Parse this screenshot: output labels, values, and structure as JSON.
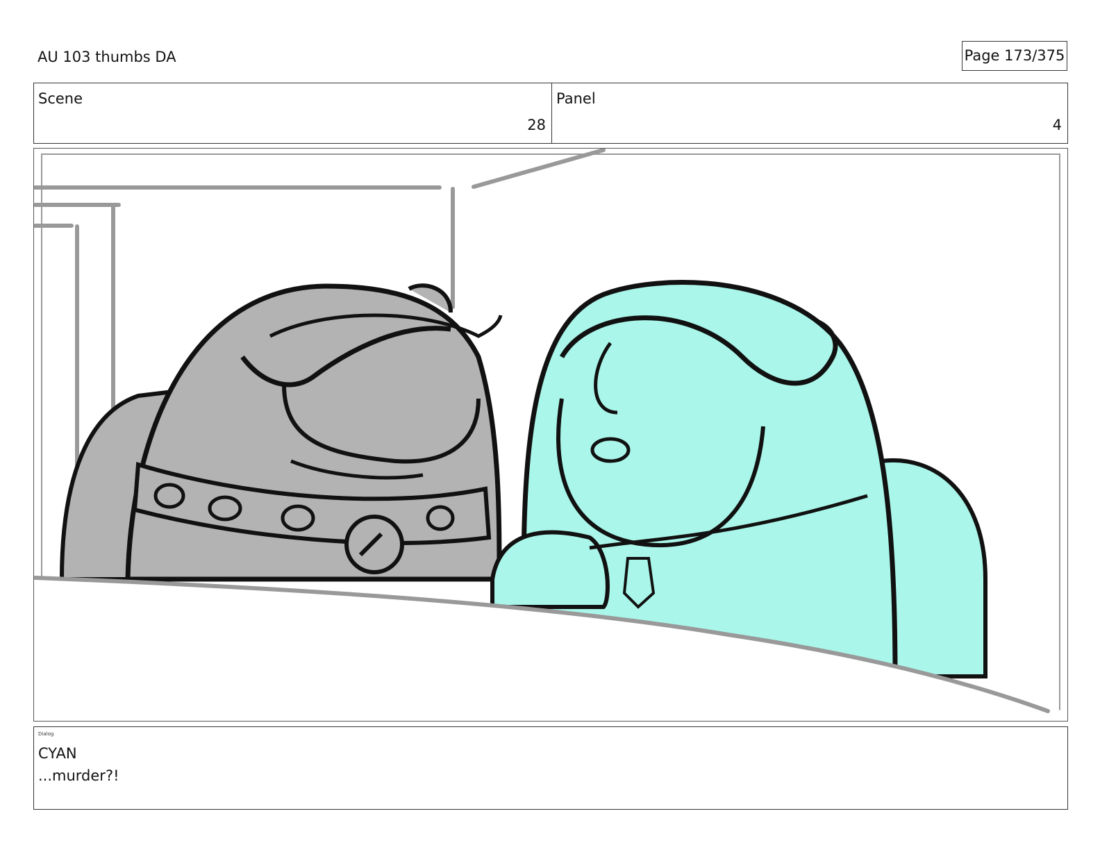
{
  "header": {
    "title": "AU 103 thumbs DA",
    "page": "Page 173/375"
  },
  "info": {
    "scene_label": "Scene",
    "scene_value": "28",
    "panel_label": "Panel",
    "panel_value": "4"
  },
  "panel_art": {
    "description_icons": [
      "grey-character",
      "cyan-character",
      "spiked-collar",
      "lantern-pendant"
    ],
    "colors": {
      "grey_character": "#b3b3b3",
      "cyan_character": "#aaf6ea",
      "outline": "#111111",
      "background_lines": "#999999"
    }
  },
  "dialog": {
    "label": "Dialog",
    "speaker": "CYAN",
    "line": "...murder?!"
  }
}
